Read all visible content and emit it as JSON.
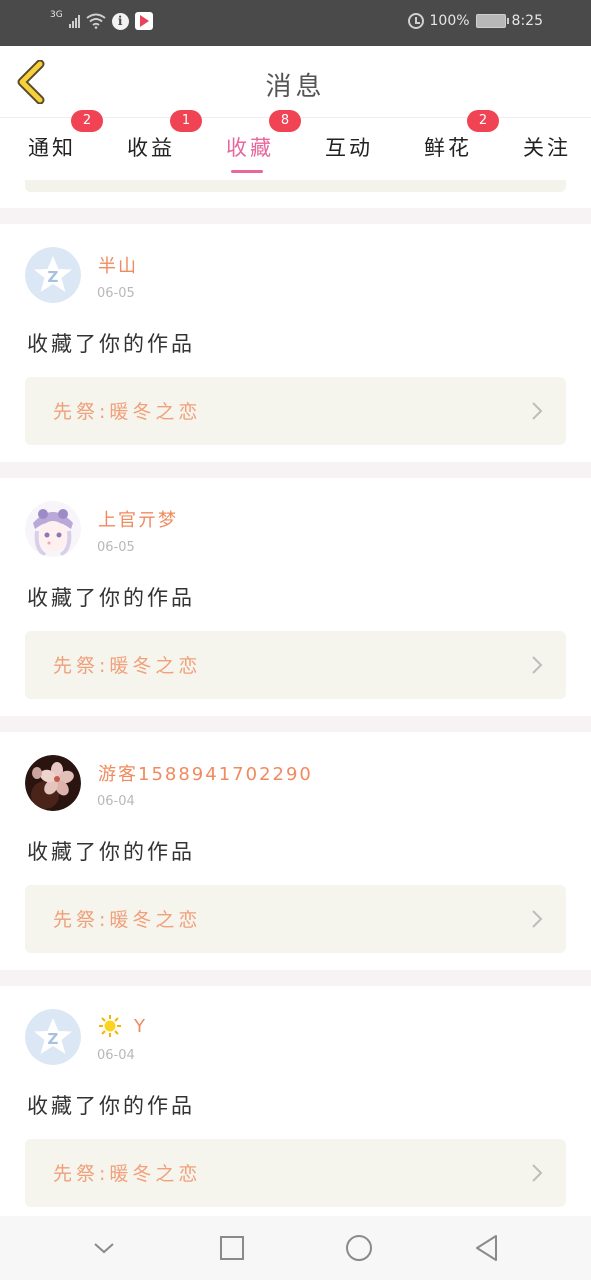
{
  "status_bar": {
    "network": "3G",
    "battery_text": "100%",
    "time": "8:25"
  },
  "header": {
    "title": "消息",
    "back_icon": "chevron-left-icon"
  },
  "tabs": [
    {
      "label": "通知",
      "badge": "2",
      "active": false
    },
    {
      "label": "收益",
      "badge": "1",
      "active": false
    },
    {
      "label": "收藏",
      "badge": "8",
      "active": true
    },
    {
      "label": "互动",
      "badge": "",
      "active": false
    },
    {
      "label": "鲜花",
      "badge": "2",
      "active": false
    },
    {
      "label": "关注",
      "badge": "",
      "active": false
    }
  ],
  "items": [
    {
      "username": "半山",
      "date": "06-05",
      "action": "收藏了你的作品",
      "work_title": "先祭:暖冬之恋",
      "avatar": "qq-default-avatar"
    },
    {
      "username": "上官亓梦",
      "date": "06-05",
      "action": "收藏了你的作品",
      "work_title": "先祭:暖冬之恋",
      "avatar": "anime-girl-avatar"
    },
    {
      "username": "游客1588941702290",
      "date": "06-04",
      "action": "收藏了你的作品",
      "work_title": "先祭:暖冬之恋",
      "avatar": "flower-photo-avatar"
    },
    {
      "username": "Y",
      "date": "06-04",
      "action": "收藏了你的作品",
      "work_title": "先祭:暖冬之恋",
      "avatar": "qq-default-avatar",
      "username_prefix_icon": "sun-icon"
    }
  ],
  "colors": {
    "accent_pink": "#e8679c",
    "badge_red": "#f04354",
    "username_orange": "#f08a5f",
    "work_title_orange": "#f0a07a",
    "back_icon_yellow": "#f5d23c"
  }
}
